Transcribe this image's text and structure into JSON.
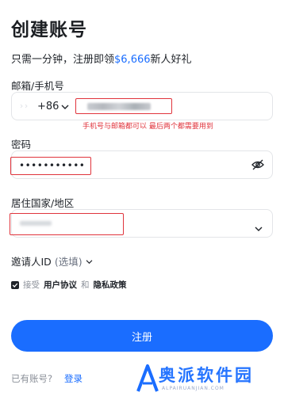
{
  "page": {
    "title": "创建账号",
    "subtitle_prefix": "只需一分钟，注册即领",
    "subtitle_amount": "$6,666",
    "subtitle_suffix": "新人好礼"
  },
  "email_phone": {
    "label": "邮箱/手机号",
    "country_code": "+86"
  },
  "annotation": "手机号与邮箱都可以 最后两个都需要用到",
  "password": {
    "label": "密码",
    "value": "•••••••••••"
  },
  "country": {
    "label": "居住国家/地区"
  },
  "inviter": {
    "label": "邀请人ID",
    "optional": "(选填)"
  },
  "agreement": {
    "accept": "接受",
    "user_agreement": "用户协议",
    "and": "和",
    "privacy_policy": "隐私政策"
  },
  "register_button": "注册",
  "footer": {
    "have_account": "已有账号?",
    "login": "登录"
  },
  "watermark": {
    "text": "奥派软件园",
    "url": "ALPAIRUANJIAN.COM"
  },
  "colors": {
    "accent": "#1a6dff",
    "annotation_red": "#e0343c"
  }
}
